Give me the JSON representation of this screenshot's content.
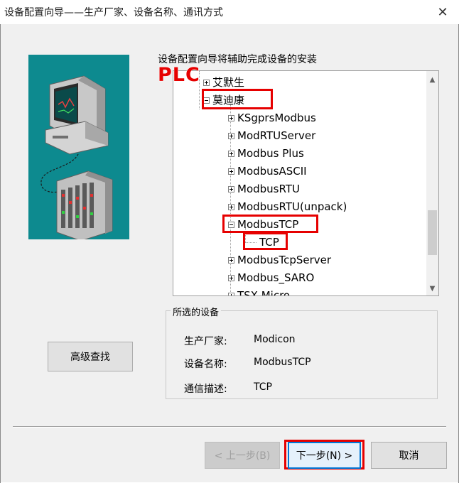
{
  "window": {
    "title": "设备配置向导——生产厂家、设备名称、通讯方式",
    "close_glyph": "✕"
  },
  "wizard": {
    "prompt": "设备配置向导将辅助完成设备的安装",
    "annotation_label": "PLC"
  },
  "tree": {
    "items": [
      {
        "label": "艾默生",
        "expander": "+",
        "level": 0
      },
      {
        "label": "莫迪康",
        "expander": "-",
        "level": 0
      },
      {
        "label": "KSgprsModbus",
        "expander": "+",
        "level": 1
      },
      {
        "label": "ModRTUServer",
        "expander": "+",
        "level": 1
      },
      {
        "label": "Modbus Plus",
        "expander": "+",
        "level": 1
      },
      {
        "label": "ModbusASCII",
        "expander": "+",
        "level": 1
      },
      {
        "label": "ModbusRTU",
        "expander": "+",
        "level": 1
      },
      {
        "label": "ModbusRTU(unpack)",
        "expander": "+",
        "level": 1
      },
      {
        "label": "ModbusTCP",
        "expander": "-",
        "level": 1
      },
      {
        "label": "TCP",
        "expander": "",
        "level": 2
      },
      {
        "label": "ModbusTcpServer",
        "expander": "+",
        "level": 1
      },
      {
        "label": "Modbus_SARO",
        "expander": "+",
        "level": 1
      },
      {
        "label": "TSX Micro",
        "expander": "+",
        "level": 1
      }
    ]
  },
  "selected_device": {
    "legend": "所选的设备",
    "manufacturer_label": "生产厂家:",
    "manufacturer_value": "Modicon",
    "device_label": "设备名称:",
    "device_value": "ModbusTCP",
    "comm_label": "通信描述:",
    "comm_value": "TCP"
  },
  "buttons": {
    "advanced_search": "高级查找",
    "back": "< 上一步(B)",
    "next": "下一步(N) >",
    "cancel": "取消"
  },
  "colors": {
    "illustration_bg": "#0d8a8f",
    "highlight_red": "#e60000"
  }
}
